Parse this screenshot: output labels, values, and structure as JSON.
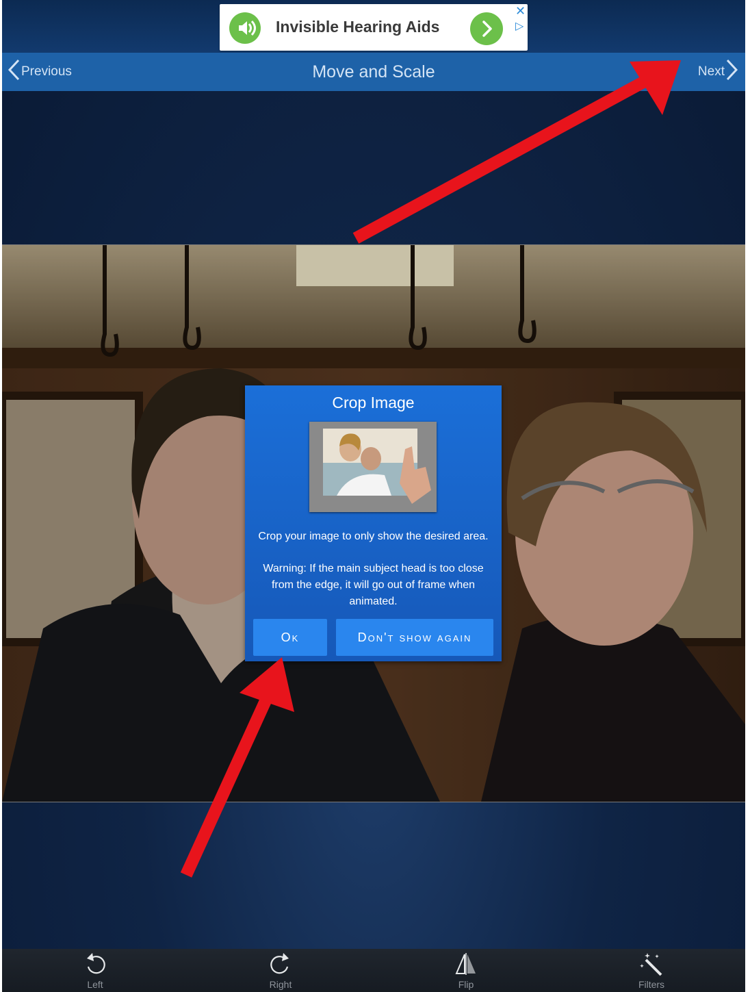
{
  "ad": {
    "title": "Invisible Hearing Aids",
    "close_glyph": "✕",
    "choices_glyph": "▷",
    "icon": "speaker-icon",
    "go_icon": "chevron-right-icon"
  },
  "nav": {
    "previous_label": "Previous",
    "title": "Move and Scale",
    "next_label": "Next"
  },
  "dialog": {
    "title": "Crop Image",
    "message": "Crop your image to only show the desired area.",
    "warning": "Warning: If the main subject head is too close from the edge, it will go out of frame when animated.",
    "ok_label": "Ok",
    "dont_show_label": "Don't show again"
  },
  "toolbar": {
    "items": [
      {
        "label": "Left",
        "icon": "rotate-left-icon"
      },
      {
        "label": "Right",
        "icon": "rotate-right-icon"
      },
      {
        "label": "Flip",
        "icon": "flip-icon"
      },
      {
        "label": "Filters",
        "icon": "magic-wand-icon"
      }
    ]
  },
  "colors": {
    "navbar": "#1e62a8",
    "dialog": "#1b6fd8",
    "dialog_button": "#2a86ee",
    "annotation_arrow": "#e8141c",
    "ad_green": "#6cc04a"
  }
}
